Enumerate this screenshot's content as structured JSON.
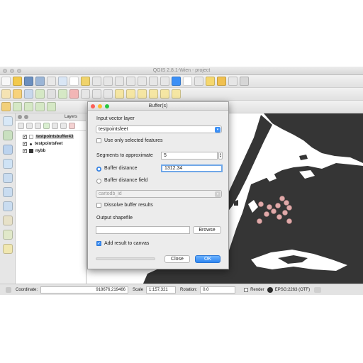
{
  "app": {
    "title": "QGIS 2.8.1-Wien - project"
  },
  "layers_panel": {
    "title": "Layers",
    "items": [
      {
        "label": "testpointsbuffer43",
        "checked": true,
        "bold": true
      },
      {
        "label": "testpointsfeet",
        "checked": true,
        "bold": true
      },
      {
        "label": "nybb",
        "checked": true,
        "bold": true
      }
    ]
  },
  "dialog": {
    "title": "Buffer(s)",
    "input_label": "Input vector layer",
    "input_value": "testpointsfeet",
    "selected_only_label": "Use only selected features",
    "segments_label": "Segments to approximate",
    "segments_value": "5",
    "buffer_distance_label": "Buffer distance",
    "buffer_distance_value": "1312.34",
    "buffer_field_label": "Buffer distance field",
    "buffer_field_value": "cartodb_id",
    "dissolve_label": "Dissolve buffer results",
    "output_label": "Output shapefile",
    "output_value": "",
    "browse_label": "Browse",
    "add_result_label": "Add result to canvas",
    "close_label": "Close",
    "ok_label": "OK"
  },
  "statusbar": {
    "coordinate_label": "Coordinate:",
    "coordinate_value": "918676,219466",
    "scale_label": "Scale",
    "scale_value": "1:157,321",
    "rotation_label": "Rotation:",
    "rotation_value": "0.0",
    "render_label": "Render",
    "crs_label": "EPSG:2263 (OTF)"
  },
  "colors": {
    "land": "#353535",
    "water": "#ffffff",
    "points": "#e0a9a9",
    "accent": "#3b8ff6"
  }
}
